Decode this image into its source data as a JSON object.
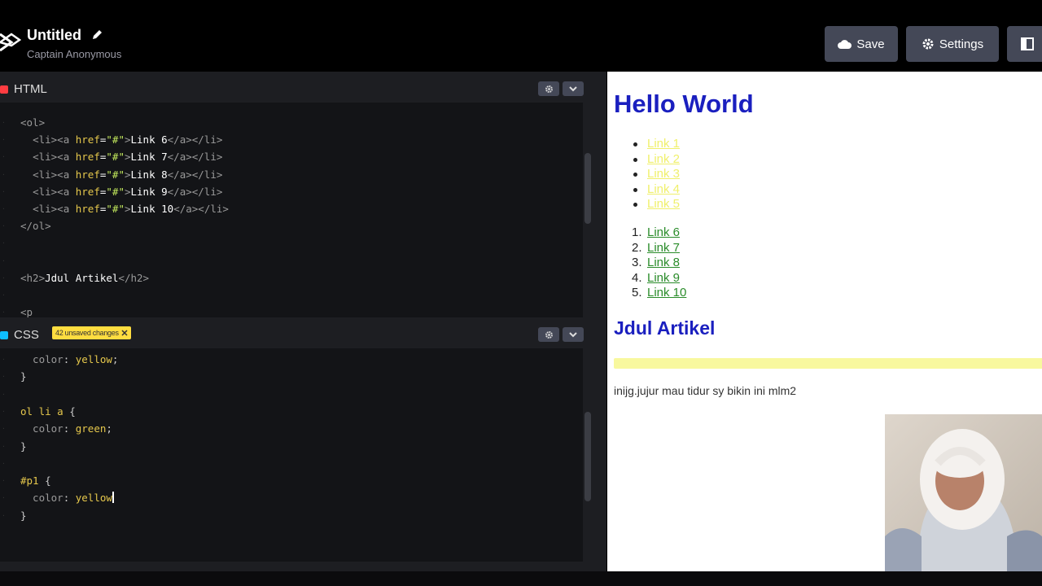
{
  "header": {
    "title": "Untitled",
    "owner": "Captain Anonymous",
    "save_label": "Save",
    "settings_label": "Settings"
  },
  "html_panel": {
    "label": "HTML",
    "lines": [
      {
        "parts": [
          [
            "tag",
            "<ol>"
          ]
        ]
      },
      {
        "parts": [
          [
            "txt",
            "  "
          ],
          [
            "tag",
            "<li><a "
          ],
          [
            "attr",
            "href"
          ],
          [
            "txt",
            "="
          ],
          [
            "val",
            "\"#\""
          ],
          [
            "tag",
            ">"
          ],
          [
            "txt",
            "Link 6"
          ],
          [
            "tag",
            "</a></li>"
          ]
        ]
      },
      {
        "parts": [
          [
            "txt",
            "  "
          ],
          [
            "tag",
            "<li><a "
          ],
          [
            "attr",
            "href"
          ],
          [
            "txt",
            "="
          ],
          [
            "val",
            "\"#\""
          ],
          [
            "tag",
            ">"
          ],
          [
            "txt",
            "Link 7"
          ],
          [
            "tag",
            "</a></li>"
          ]
        ]
      },
      {
        "parts": [
          [
            "txt",
            "  "
          ],
          [
            "tag",
            "<li><a "
          ],
          [
            "attr",
            "href"
          ],
          [
            "txt",
            "="
          ],
          [
            "val",
            "\"#\""
          ],
          [
            "tag",
            ">"
          ],
          [
            "txt",
            "Link 8"
          ],
          [
            "tag",
            "</a></li>"
          ]
        ]
      },
      {
        "parts": [
          [
            "txt",
            "  "
          ],
          [
            "tag",
            "<li><a "
          ],
          [
            "attr",
            "href"
          ],
          [
            "txt",
            "="
          ],
          [
            "val",
            "\"#\""
          ],
          [
            "tag",
            ">"
          ],
          [
            "txt",
            "Link 9"
          ],
          [
            "tag",
            "</a></li>"
          ]
        ]
      },
      {
        "parts": [
          [
            "txt",
            "  "
          ],
          [
            "tag",
            "<li><a "
          ],
          [
            "attr",
            "href"
          ],
          [
            "txt",
            "="
          ],
          [
            "val",
            "\"#\""
          ],
          [
            "tag",
            ">"
          ],
          [
            "txt",
            "Link 10"
          ],
          [
            "tag",
            "</a></li>"
          ]
        ]
      },
      {
        "parts": [
          [
            "tag",
            "</ol>"
          ]
        ]
      },
      {
        "parts": []
      },
      {
        "parts": []
      },
      {
        "parts": [
          [
            "tag",
            "<h2>"
          ],
          [
            "txt",
            "Jdul Artikel"
          ],
          [
            "tag",
            "</h2>"
          ]
        ]
      },
      {
        "parts": []
      },
      {
        "parts": [
          [
            "tag",
            "<p"
          ]
        ]
      }
    ]
  },
  "css_panel": {
    "label": "CSS",
    "unsaved_label": "42 unsaved changes",
    "lines": [
      {
        "parts": [
          [
            "prop",
            "  color"
          ],
          [
            "punc",
            ": "
          ],
          [
            "cssval",
            "yellow"
          ],
          [
            "punc",
            ";"
          ]
        ]
      },
      {
        "parts": [
          [
            "punc",
            "}"
          ]
        ]
      },
      {
        "parts": []
      },
      {
        "parts": [
          [
            "sel",
            "ol li a"
          ],
          [
            "punc",
            " {"
          ]
        ]
      },
      {
        "parts": [
          [
            "prop",
            "  color"
          ],
          [
            "punc",
            ": "
          ],
          [
            "cssval",
            "green"
          ],
          [
            "punc",
            ";"
          ]
        ]
      },
      {
        "parts": [
          [
            "punc",
            "}"
          ]
        ]
      },
      {
        "parts": []
      },
      {
        "parts": [
          [
            "sel",
            "#p1"
          ],
          [
            "punc",
            " {"
          ]
        ]
      },
      {
        "parts": [
          [
            "prop",
            "  color"
          ],
          [
            "punc",
            ": "
          ],
          [
            "cssval",
            "yellow"
          ],
          [
            "cursor",
            ""
          ]
        ]
      },
      {
        "parts": [
          [
            "punc",
            "}"
          ]
        ]
      }
    ]
  },
  "preview": {
    "heading": "Hello World",
    "ul_links": [
      "Link 1",
      "Link 2",
      "Link 3",
      "Link 4",
      "Link 5"
    ],
    "ol_links": [
      "Link 6",
      "Link 7",
      "Link 8",
      "Link 9",
      "Link 10"
    ],
    "subheading": "Jdul Artikel",
    "paragraph": "inijg.jujur mau tidur sy bikin ini mlm2"
  },
  "colors": {
    "accent_yellow": "#ffdd40",
    "heading_blue": "#1a1fbf",
    "link_green": "#2a8c2a",
    "link_yellow": "#f0f06c"
  }
}
